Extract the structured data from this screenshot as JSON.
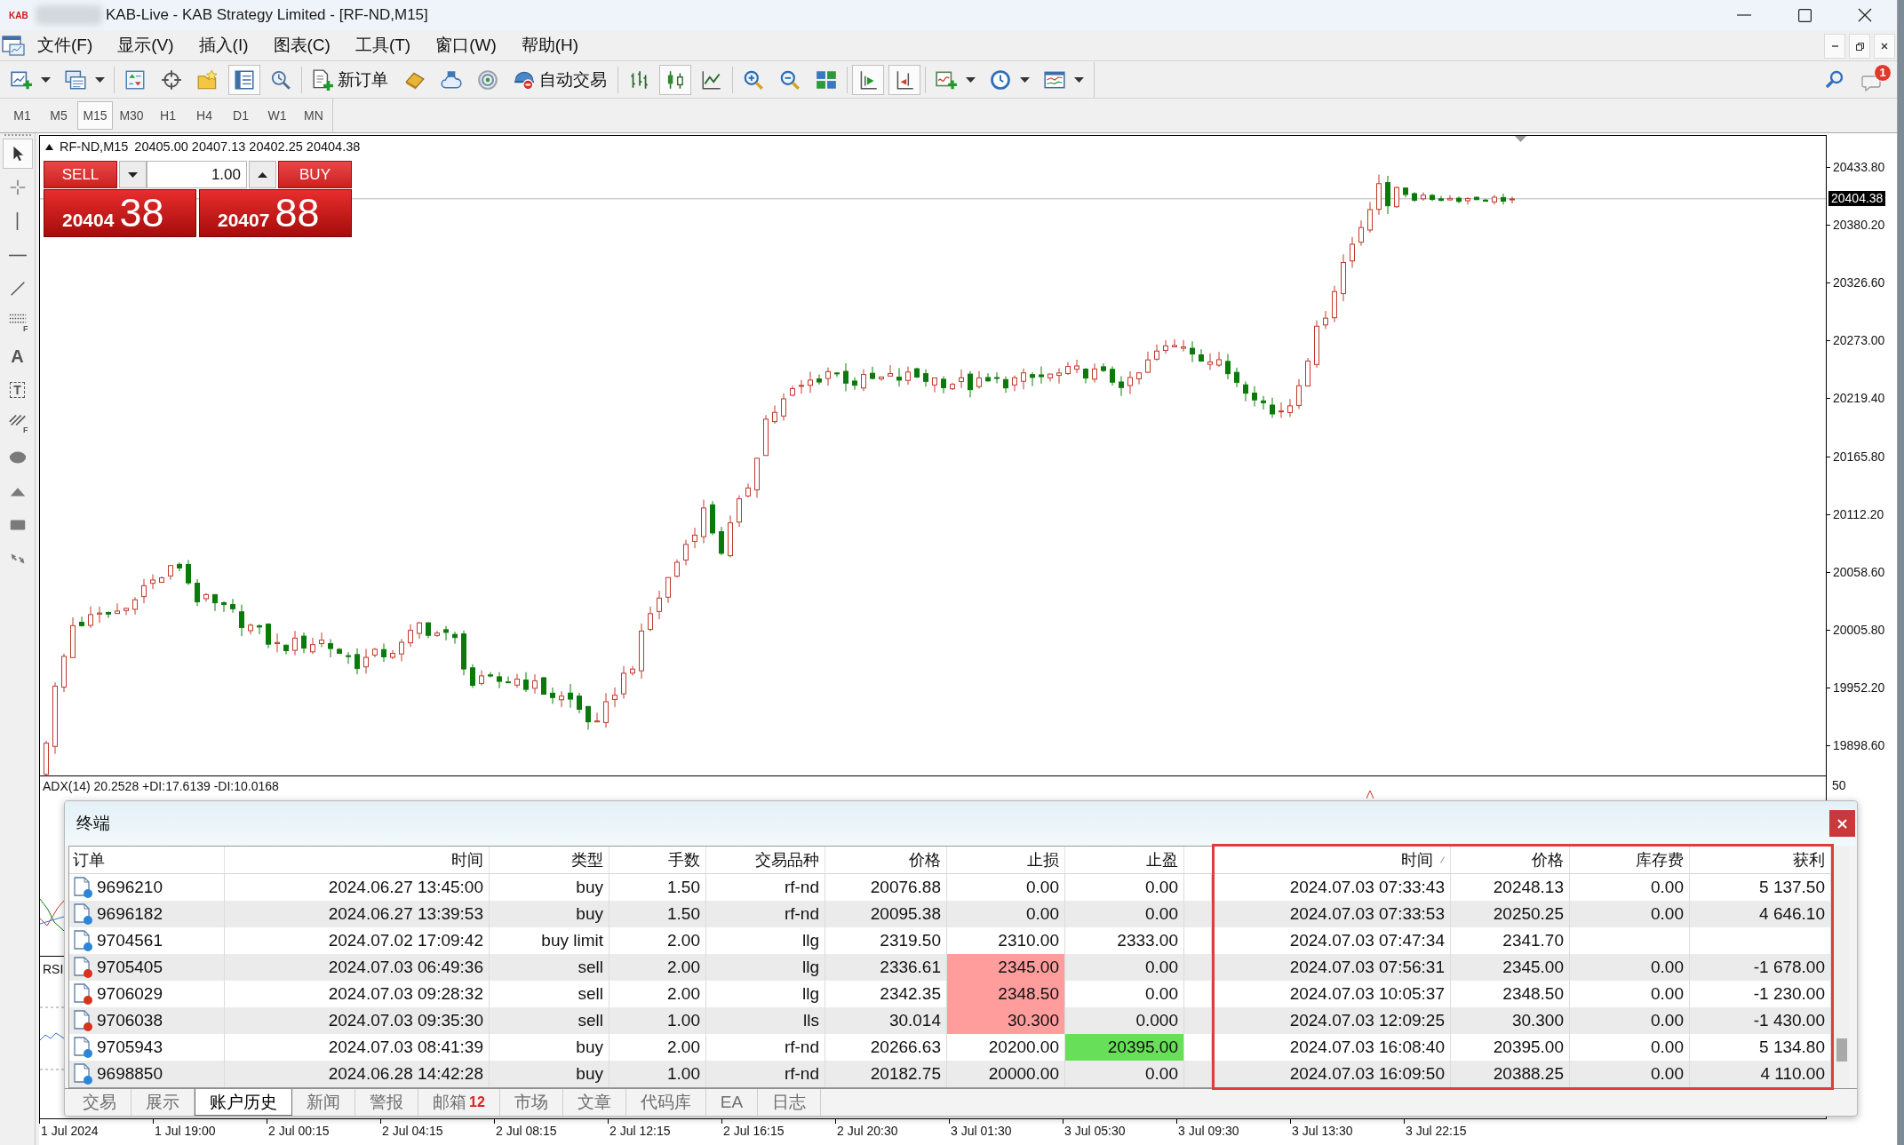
{
  "window": {
    "logo": "KAB",
    "title": "KAB-Live - KAB Strategy Limited - [RF-ND,M15]"
  },
  "menu": [
    "文件(F)",
    "显示(V)",
    "插入(I)",
    "图表(C)",
    "工具(T)",
    "窗口(W)",
    "帮助(H)"
  ],
  "toolbar": {
    "groups": [
      {
        "items": [
          {
            "kind": "new_chart",
            "pressed": false,
            "dropdown": true
          },
          {
            "kind": "profiles",
            "pressed": false,
            "dropdown": true
          }
        ]
      },
      {
        "items": [
          {
            "kind": "market_watch",
            "pressed": false
          },
          {
            "kind": "data_window",
            "pressed": false
          },
          {
            "kind": "navigator",
            "pressed": false
          },
          {
            "kind": "terminal",
            "pressed": true
          },
          {
            "kind": "tester",
            "pressed": false
          }
        ]
      },
      {
        "items": [
          {
            "kind": "new_order",
            "pressed": false,
            "label": "新订单"
          },
          {
            "kind": "market",
            "pressed": false
          },
          {
            "kind": "vps",
            "pressed": false
          },
          {
            "kind": "signals",
            "pressed": false
          },
          {
            "kind": "autotrading",
            "pressed": false,
            "label": "自动交易"
          }
        ]
      },
      {
        "items": [
          {
            "kind": "bar_chart",
            "pressed": false
          },
          {
            "kind": "candles",
            "pressed": true
          },
          {
            "kind": "line_chart",
            "pressed": false
          }
        ]
      },
      {
        "items": [
          {
            "kind": "zoom_in",
            "pressed": false
          },
          {
            "kind": "zoom_out",
            "pressed": false
          },
          {
            "kind": "tile",
            "pressed": false
          }
        ]
      },
      {
        "items": [
          {
            "kind": "autoscroll",
            "pressed": true
          },
          {
            "kind": "chart_shift",
            "pressed": true
          }
        ]
      },
      {
        "items": [
          {
            "kind": "indicators",
            "pressed": false,
            "dropdown": true
          },
          {
            "kind": "periods",
            "pressed": false,
            "dropdown": true
          },
          {
            "kind": "templates",
            "pressed": false,
            "dropdown": true
          }
        ]
      }
    ]
  },
  "messages": {
    "badge": "1"
  },
  "timeframes": [
    {
      "label": "M1",
      "selected": false
    },
    {
      "label": "M5",
      "selected": false
    },
    {
      "label": "M15",
      "selected": true
    },
    {
      "label": "M30",
      "selected": false
    },
    {
      "label": "H1",
      "selected": false
    },
    {
      "label": "H4",
      "selected": false
    },
    {
      "label": "D1",
      "selected": false
    },
    {
      "label": "W1",
      "selected": false
    },
    {
      "label": "MN",
      "selected": false
    }
  ],
  "drawing_tools": [
    {
      "kind": "cursor",
      "selected": true
    },
    {
      "kind": "crosshair",
      "selected": false
    },
    {
      "kind": "vline",
      "selected": false
    },
    {
      "kind": "hline",
      "selected": false
    },
    {
      "kind": "trendline",
      "selected": false
    },
    {
      "kind": "fibo",
      "glyph": "F",
      "selected": false
    },
    {
      "kind": "text",
      "glyph": "A",
      "selected": false
    },
    {
      "kind": "label",
      "glyph": "T",
      "selected": false
    },
    {
      "kind": "fibo_channel",
      "glyph": "F",
      "selected": false
    },
    {
      "kind": "ellipse",
      "selected": false
    },
    {
      "kind": "triangle",
      "selected": false
    },
    {
      "kind": "rectangle",
      "selected": false
    },
    {
      "kind": "arrows",
      "selected": false
    }
  ],
  "chart": {
    "symbol": "RF-ND,M15",
    "ohlc": "20405.00 20407.13 20402.25 20404.38",
    "trade_panel": {
      "sell": {
        "label": "SELL",
        "price": "20404",
        "pips": "38"
      },
      "lot": "1.00",
      "buy": {
        "label": "BUY",
        "price": "20407",
        "pips": "88"
      }
    },
    "price_axis": [
      "20433.80",
      "20380.20",
      "20326.60",
      "20273.00",
      "20219.40",
      "20165.80",
      "20112.20",
      "20058.60",
      "20005.80",
      "19952.20",
      "19898.60"
    ],
    "current_price": "20404.38",
    "indicator_panes": [
      {
        "kind": "adx",
        "label": "ADX(14) 20.2528 +DI:17.6139 -DI:10.0168",
        "axis": [
          "50"
        ]
      },
      {
        "kind": "rsi",
        "label": "RSI"
      }
    ],
    "time_axis": [
      "1 Jul 2024",
      "1 Jul 19:00",
      "2 Jul 00:15",
      "2 Jul 04:15",
      "2 Jul 08:15",
      "2 Jul 12:15",
      "2 Jul 16:15",
      "2 Jul 20:30",
      "3 Jul 01:30",
      "3 Jul 05:30",
      "3 Jul 09:30",
      "3 Jul 13:30",
      "3 Jul 22:15"
    ]
  },
  "terminal": {
    "title": "终端",
    "columns": [
      {
        "label": "订单",
        "sorted": false
      },
      {
        "label": "时间",
        "sorted": false
      },
      {
        "label": "类型",
        "sorted": false
      },
      {
        "label": "手数",
        "sorted": false
      },
      {
        "label": "交易品种",
        "sorted": false
      },
      {
        "label": "价格",
        "sorted": false
      },
      {
        "label": "止损",
        "sorted": false
      },
      {
        "label": "止盈",
        "sorted": false
      },
      {
        "label": "时间",
        "sorted": true
      },
      {
        "label": "价格",
        "sorted": false
      },
      {
        "label": "库存费",
        "sorted": false
      },
      {
        "label": "获利",
        "sorted": false
      }
    ],
    "rows": [
      {
        "order": "9696210",
        "color": "#2b86d8",
        "open_time": "2024.06.27 13:45:00",
        "type": "buy",
        "lots": "1.50",
        "symbol": "rf-nd",
        "price": "20076.88",
        "sl": "0.00",
        "tp": "0.00",
        "sl_hit": false,
        "tp_hit": false,
        "close_time": "2024.07.03 07:33:43",
        "close_price": "20248.13",
        "swap": "0.00",
        "profit": "5 137.50"
      },
      {
        "order": "9696182",
        "color": "#2b86d8",
        "open_time": "2024.06.27 13:39:53",
        "type": "buy",
        "lots": "1.50",
        "symbol": "rf-nd",
        "price": "20095.38",
        "sl": "0.00",
        "tp": "0.00",
        "sl_hit": false,
        "tp_hit": false,
        "close_time": "2024.07.03 07:33:53",
        "close_price": "20250.25",
        "swap": "0.00",
        "profit": "4 646.10"
      },
      {
        "order": "9704561",
        "color": "#2b86d8",
        "open_time": "2024.07.02 17:09:42",
        "type": "buy limit",
        "lots": "2.00",
        "symbol": "llg",
        "price": "2319.50",
        "sl": "2310.00",
        "tp": "2333.00",
        "sl_hit": false,
        "tp_hit": false,
        "close_time": "2024.07.03 07:47:34",
        "close_price": "2341.70"
      },
      {
        "order": "9705405",
        "color": "#d8321c",
        "open_time": "2024.07.03 06:49:36",
        "type": "sell",
        "lots": "2.00",
        "symbol": "llg",
        "price": "2336.61",
        "sl": "2345.00",
        "tp": "0.00",
        "sl_hit": true,
        "tp_hit": false,
        "close_time": "2024.07.03 07:56:31",
        "close_price": "2345.00",
        "swap": "0.00",
        "profit": "-1 678.00"
      },
      {
        "order": "9706029",
        "color": "#d8321c",
        "open_time": "2024.07.03 09:28:32",
        "type": "sell",
        "lots": "2.00",
        "symbol": "llg",
        "price": "2342.35",
        "sl": "2348.50",
        "tp": "0.00",
        "sl_hit": true,
        "tp_hit": false,
        "close_time": "2024.07.03 10:05:37",
        "close_price": "2348.50",
        "swap": "0.00",
        "profit": "-1 230.00"
      },
      {
        "order": "9706038",
        "color": "#d8321c",
        "open_time": "2024.07.03 09:35:30",
        "type": "sell",
        "lots": "1.00",
        "symbol": "lls",
        "price": "30.014",
        "sl": "30.300",
        "tp": "0.000",
        "sl_hit": true,
        "tp_hit": false,
        "close_time": "2024.07.03 12:09:25",
        "close_price": "30.300",
        "swap": "0.00",
        "profit": "-1 430.00"
      },
      {
        "order": "9705943",
        "color": "#2b86d8",
        "open_time": "2024.07.03 08:41:39",
        "type": "buy",
        "lots": "2.00",
        "symbol": "rf-nd",
        "price": "20266.63",
        "sl": "20200.00",
        "tp": "20395.00",
        "sl_hit": false,
        "tp_hit": true,
        "close_time": "2024.07.03 16:08:40",
        "close_price": "20395.00",
        "swap": "0.00",
        "profit": "5 134.80"
      },
      {
        "order": "9698850",
        "color": "#2b86d8",
        "open_time": "2024.06.28 14:42:28",
        "type": "buy",
        "lots": "1.00",
        "symbol": "rf-nd",
        "price": "20182.75",
        "sl": "20000.00",
        "tp": "0.00",
        "sl_hit": false,
        "tp_hit": false,
        "close_time": "2024.07.03 16:09:50",
        "close_price": "20388.25",
        "swap": "0.00",
        "profit": "4 110.00"
      }
    ],
    "tabs": [
      {
        "label": "交易",
        "selected": false
      },
      {
        "label": "展示",
        "selected": false
      },
      {
        "label": "账户历史",
        "selected": true
      },
      {
        "label": "新闻",
        "selected": false
      },
      {
        "label": "警报",
        "selected": false
      },
      {
        "label": "邮箱",
        "badge": "12",
        "selected": false
      },
      {
        "label": "市场",
        "selected": false
      },
      {
        "label": "文章",
        "selected": false
      },
      {
        "label": "代码库",
        "selected": false
      },
      {
        "label": "EA",
        "selected": false
      },
      {
        "label": "日志",
        "selected": false
      }
    ]
  }
}
